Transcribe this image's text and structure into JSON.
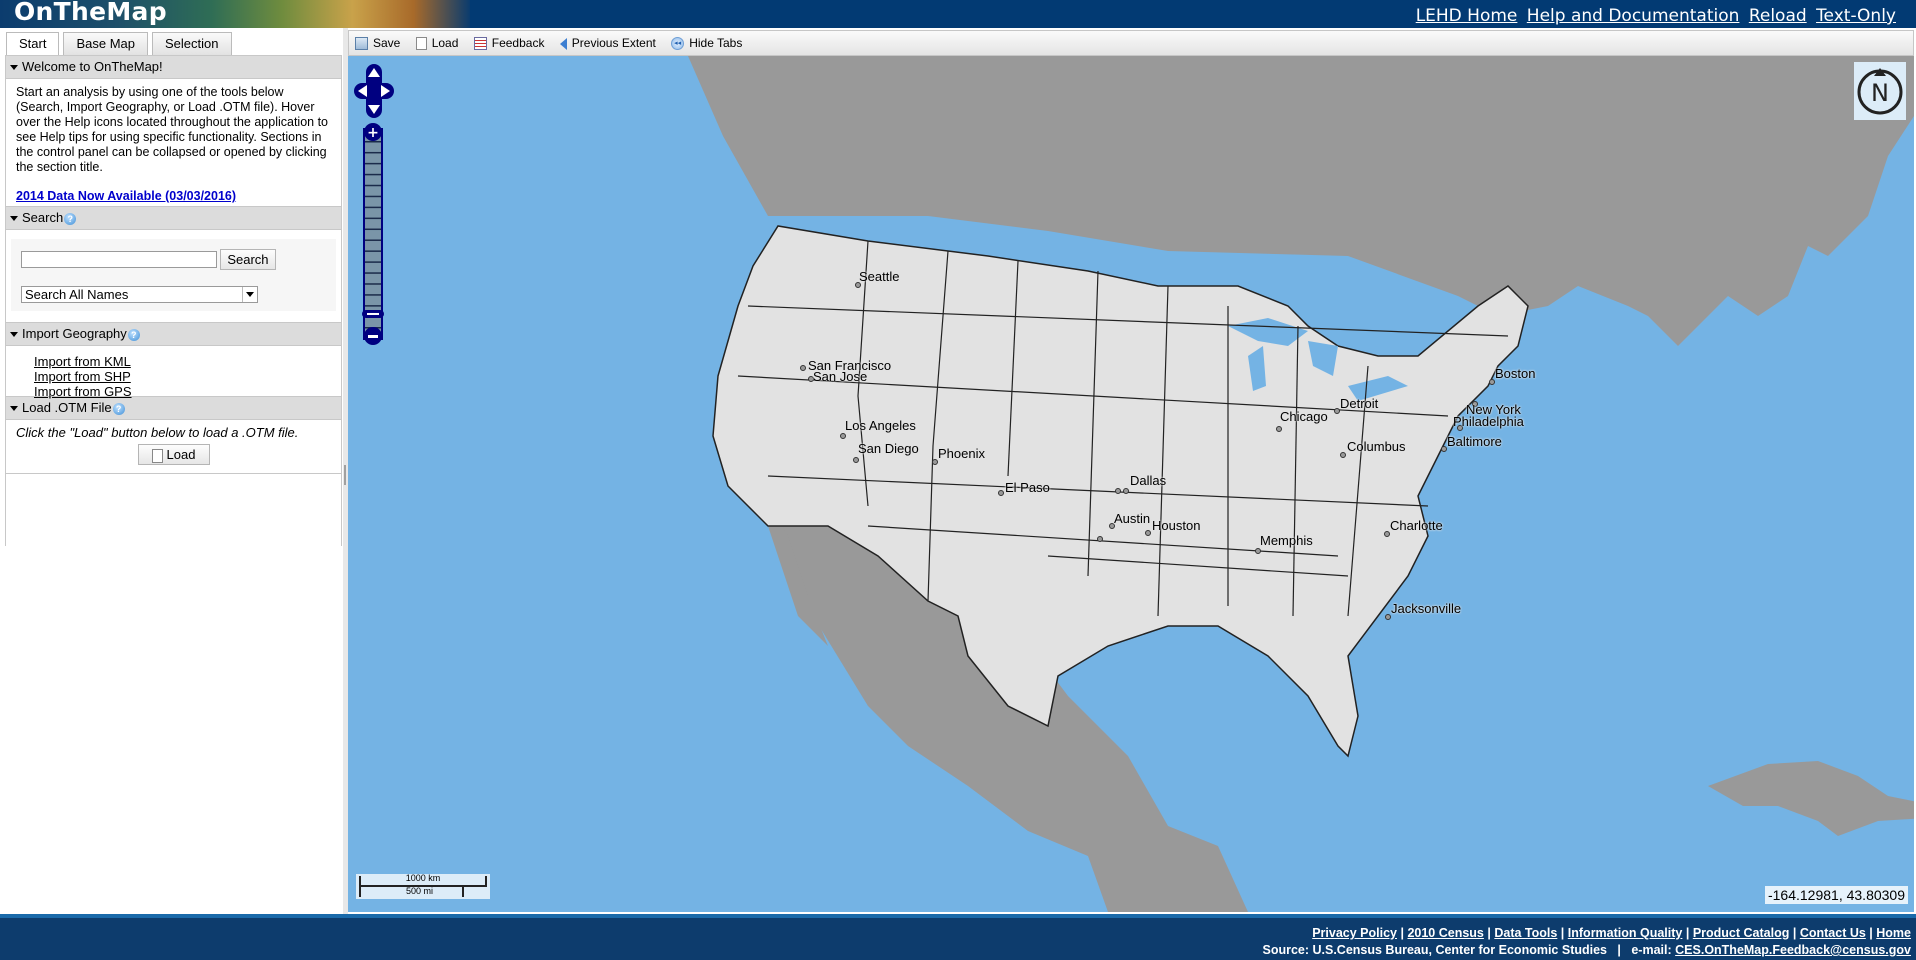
{
  "header": {
    "app_title": "OnTheMap",
    "links": [
      "LEHD Home",
      "Help and Documentation",
      "Reload",
      "Text-Only"
    ]
  },
  "tabs": [
    {
      "label": "Start",
      "active": true
    },
    {
      "label": "Base Map",
      "active": false
    },
    {
      "label": "Selection",
      "active": false
    }
  ],
  "sections": {
    "welcome": {
      "title": "Welcome to OnTheMap!",
      "text": "Start an analysis by using one of the tools below (Search, Import Geography, or Load .OTM file). Hover over the Help icons located throughout the application to see Help tips for using specific functionality. Sections in the control panel can be collapsed or opened by clicking the section title.",
      "news_link": "2014 Data Now Available (03/03/2016)"
    },
    "search": {
      "title": "Search",
      "input_value": "",
      "input_placeholder": "",
      "button_label": "Search",
      "select_value": "Search All Names"
    },
    "import": {
      "title": "Import Geography",
      "links": [
        "Import from KML",
        "Import from SHP",
        "Import from GPS"
      ]
    },
    "load": {
      "title": "Load .OTM File",
      "text": "Click the \"Load\" button below to load a .OTM file.",
      "button_label": "Load"
    }
  },
  "toolbar": {
    "items": [
      {
        "label": "Save",
        "icon": "save-icon"
      },
      {
        "label": "Load",
        "icon": "document-icon"
      },
      {
        "label": "Feedback",
        "icon": "feedback-icon"
      },
      {
        "label": "Previous Extent",
        "icon": "back-arrow-icon"
      },
      {
        "label": "Hide Tabs",
        "icon": "rewind-icon"
      }
    ]
  },
  "map": {
    "colors": {
      "water": "#74b3e4",
      "us_land": "#e2e2e2",
      "other_land": "#999999",
      "controls": "#000080"
    },
    "cities": [
      "Seattle",
      "San Francisco",
      "San Jose",
      "Los Angeles",
      "San Diego",
      "Phoenix",
      "El Paso",
      "Dallas",
      "Austin",
      "Houston",
      "Memphis",
      "Chicago",
      "Detroit",
      "Columbus",
      "Charlotte",
      "Jacksonville",
      "Boston",
      "New York",
      "Philadelphia",
      "Baltimore"
    ],
    "scale": {
      "km_label": "1000 km",
      "mi_label": "500 mi"
    },
    "north_label": "N",
    "coordinates": "-164.12981, 43.80309",
    "zoom_level_fraction": 0.07
  },
  "footer": {
    "links": [
      "Privacy Policy",
      "2010 Census",
      "Data Tools",
      "Information Quality",
      "Product Catalog",
      "Contact Us",
      "Home"
    ],
    "source_text": "Source: U.S.Census Bureau, Center for Economic Studies",
    "email_label": "e-mail:",
    "email": "CES.OnTheMap.Feedback@census.gov"
  }
}
